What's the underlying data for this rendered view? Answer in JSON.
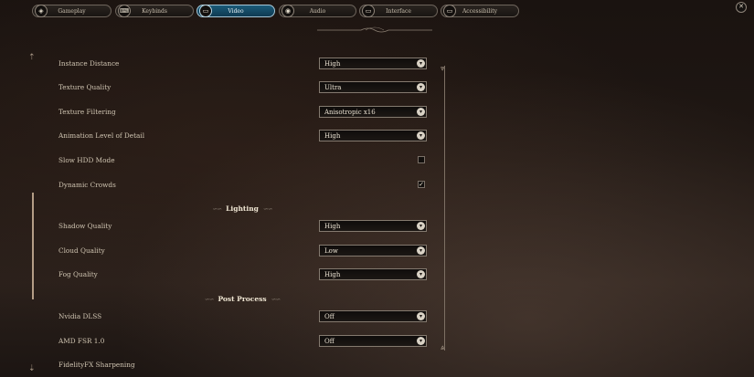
{
  "tabs": [
    {
      "label": "Gameplay",
      "icon": "gameplay-icon",
      "glyph": "◈",
      "active": false
    },
    {
      "label": "Keybinds",
      "icon": "keybinds-icon",
      "glyph": "⌨",
      "active": false
    },
    {
      "label": "Video",
      "icon": "video-icon",
      "glyph": "▭",
      "active": true
    },
    {
      "label": "Audio",
      "icon": "audio-icon",
      "glyph": "◉",
      "active": false
    },
    {
      "label": "Interface",
      "icon": "interface-icon",
      "glyph": "▭",
      "active": false
    },
    {
      "label": "Accessibility",
      "icon": "accessibility-icon",
      "glyph": "▭",
      "active": false
    }
  ],
  "close_glyph": "✕",
  "settings": {
    "instance_distance": {
      "label": "Instance Distance",
      "value": "High"
    },
    "texture_quality": {
      "label": "Texture Quality",
      "value": "Ultra"
    },
    "texture_filtering": {
      "label": "Texture Filtering",
      "value": "Anisotropic x16"
    },
    "animation_lod": {
      "label": "Animation Level of Detail",
      "value": "High"
    },
    "slow_hdd_mode": {
      "label": "Slow HDD Mode",
      "checked": false,
      "mark": ""
    },
    "dynamic_crowds": {
      "label": "Dynamic Crowds",
      "checked": true,
      "mark": "✓"
    },
    "lighting_header": "Lighting",
    "shadow_quality": {
      "label": "Shadow Quality",
      "value": "High"
    },
    "cloud_quality": {
      "label": "Cloud Quality",
      "value": "Low"
    },
    "fog_quality": {
      "label": "Fog Quality",
      "value": "High"
    },
    "post_process_header": "Post Process",
    "nvidia_dlss": {
      "label": "Nvidia DLSS",
      "value": "Off"
    },
    "amd_fsr": {
      "label": "AMD FSR 1.0",
      "value": "Off"
    },
    "fidelityfx_sharpening": {
      "label": "FidelityFX Sharpening"
    }
  },
  "chevron_glyph": "▾",
  "colors": {
    "active_tab": "#1b5a78",
    "panel_text": "#d9cdb6"
  }
}
